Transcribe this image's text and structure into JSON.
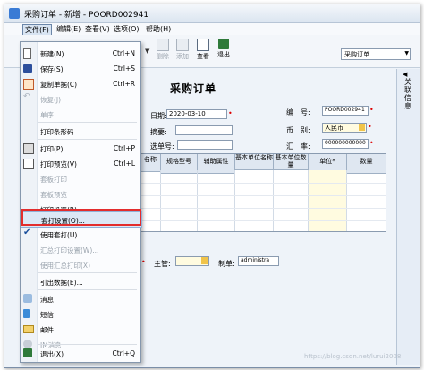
{
  "window": {
    "title": "采购订单 - 新增 - POORD002941"
  },
  "menubar": {
    "items": [
      {
        "label": "文件(F)",
        "active": true
      },
      {
        "label": "编辑(E)"
      },
      {
        "label": "查看(V)"
      },
      {
        "label": "选项(O)"
      },
      {
        "label": "帮助(H)"
      }
    ]
  },
  "toolbar": {
    "delete_label": "删除",
    "add_label": "添加",
    "view_label": "查看",
    "exit_label": "退出",
    "combo_value": "采购订单"
  },
  "dropdown": {
    "items": [
      {
        "label": "新建(N)",
        "shortcut": "Ctrl+N",
        "icon": "new-file-icon",
        "disabled": false
      },
      {
        "label": "保存(S)",
        "shortcut": "Ctrl+S",
        "icon": "save-icon",
        "disabled": false
      },
      {
        "label": "复制单据(C)",
        "shortcut": "Ctrl+R",
        "icon": "copy-icon",
        "disabled": false
      },
      {
        "label": "恢复(J)",
        "shortcut": "",
        "icon": "undo-icon",
        "disabled": true
      },
      {
        "label": "单序",
        "shortcut": "",
        "icon": "",
        "disabled": true
      },
      {
        "label": "打印条形码",
        "shortcut": "",
        "icon": "",
        "disabled": false
      },
      {
        "label": "打印(P)",
        "shortcut": "Ctrl+P",
        "icon": "print-icon",
        "disabled": false
      },
      {
        "label": "打印预览(V)",
        "shortcut": "Ctrl+L",
        "icon": "print-preview-icon",
        "disabled": false
      },
      {
        "label": "套板打印",
        "shortcut": "",
        "icon": "",
        "disabled": true
      },
      {
        "label": "套板预览",
        "shortcut": "",
        "icon": "",
        "disabled": true
      },
      {
        "label": "打印设置(R)...",
        "shortcut": "",
        "icon": "",
        "disabled": false
      },
      {
        "label": "套打设置(O)...",
        "shortcut": "",
        "icon": "",
        "disabled": false,
        "highlighted": true
      },
      {
        "label": "使用套打(U)",
        "shortcut": "",
        "icon": "check-icon",
        "disabled": false
      },
      {
        "label": "汇总打印设置(W)...",
        "shortcut": "",
        "icon": "",
        "disabled": true
      },
      {
        "label": "使用汇总打印(X)",
        "shortcut": "",
        "icon": "",
        "disabled": true
      },
      {
        "label": "引出数据(E)...",
        "shortcut": "",
        "icon": "",
        "disabled": false
      },
      {
        "label": "消息",
        "shortcut": "",
        "icon": "message-icon",
        "disabled": false
      },
      {
        "label": "短信",
        "shortcut": "",
        "icon": "sms-icon",
        "disabled": false
      },
      {
        "label": "邮件",
        "shortcut": "",
        "icon": "mail-icon",
        "disabled": false
      },
      {
        "label": "IM消息",
        "shortcut": "",
        "icon": "im-icon",
        "disabled": true
      },
      {
        "label": "退出(X)",
        "shortcut": "Ctrl+Q",
        "icon": "exit-icon",
        "disabled": false
      }
    ]
  },
  "form": {
    "title": "采购订单",
    "date_label": "日期:",
    "date_value": "2020-03-10",
    "summary_label": "摘要:",
    "source_no_label": "选单号:",
    "number_label": "编　号:",
    "number_value": "POORD002941",
    "currency_label": "币　别:",
    "currency_value": "人民币",
    "rate_label": "汇　率:",
    "rate_value": "000000000000",
    "manager_label": "主管:",
    "maker_label": "制单:",
    "maker_value": "administra"
  },
  "grid": {
    "columns": [
      "名称",
      "规格型号",
      "辅助属性",
      "基本单位名称",
      "基本单位数量",
      "单位*",
      "数量"
    ]
  },
  "sidebar": {
    "label": "关联信息"
  },
  "watermark": "https://blog.csdn.net/lurui2008"
}
